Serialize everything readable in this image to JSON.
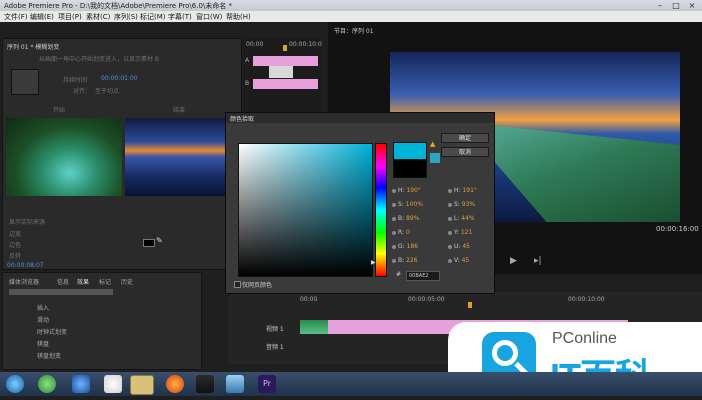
{
  "window": {
    "title": "Adobe Premiere Pro - D:\\我的文档\\Adobe\\Premiere Pro\\6.0\\未命名 *"
  },
  "menu": [
    "文件(F)",
    "编辑(E)",
    "项目(P)",
    "素材(C)",
    "序列(S)",
    "标记(M)",
    "字幕(T)",
    "窗口(W)",
    "帮助(H)"
  ],
  "effect_controls": {
    "tab": "序列 01 * 模糊划变",
    "desc": "从画面一角中心开始划变进入，以显示素材 B",
    "time1": "00:00:01:00",
    "label_a": "开始",
    "label_b": "结束",
    "continuous": "持续时间",
    "align": "对齐：",
    "align_value": "至于切点",
    "ruler_start": "00:00",
    "ruler_end": "00:00:10:0",
    "track_a": "A",
    "track_b": "B",
    "show_actual": "显示实际来源",
    "border_width": "边宽",
    "border_color": "边色",
    "reverse": "反转",
    "timecode": "00:00:08:07"
  },
  "program_monitor": {
    "tab": "节目：序列 01",
    "timecode_end": "00:00:16:00"
  },
  "effects_panel": {
    "tabs": [
      "媒体浏览器",
      "信息",
      "效果",
      "标记",
      "历史"
    ],
    "items": [
      "插入",
      "滑动",
      "时钟式划变",
      "棋盘",
      "棋盘划变"
    ]
  },
  "timeline": {
    "ruler": [
      "00:00",
      "00:00:05:00",
      "00:00:10:00"
    ],
    "track_v": "视频 1",
    "track_a": "音频 1"
  },
  "dialog": {
    "title": "颜色拾取",
    "ok": "确定",
    "cancel": "取消",
    "web_only": "仅网页颜色",
    "fields": [
      {
        "label": "H:",
        "value": "190°",
        "label2": "H:",
        "value2": "191°"
      },
      {
        "label": "S:",
        "value": "100%",
        "label2": "S:",
        "value2": "93%"
      },
      {
        "label": "B:",
        "value": "89%",
        "label2": "L:",
        "value2": "44%"
      },
      {
        "label": "R:",
        "value": "0",
        "label2": "Y:",
        "value2": "121"
      },
      {
        "label": "G:",
        "value": "186",
        "label2": "U:",
        "value2": "45"
      },
      {
        "label": "B:",
        "value": "226",
        "label2": "V:",
        "value2": "45"
      }
    ],
    "hex_prefix": "#",
    "hex": "00BAE2",
    "new_color": "#00BAE2",
    "old_color": "#000000"
  },
  "watermark": {
    "brand": "PConline",
    "slogan": "IT百科"
  }
}
